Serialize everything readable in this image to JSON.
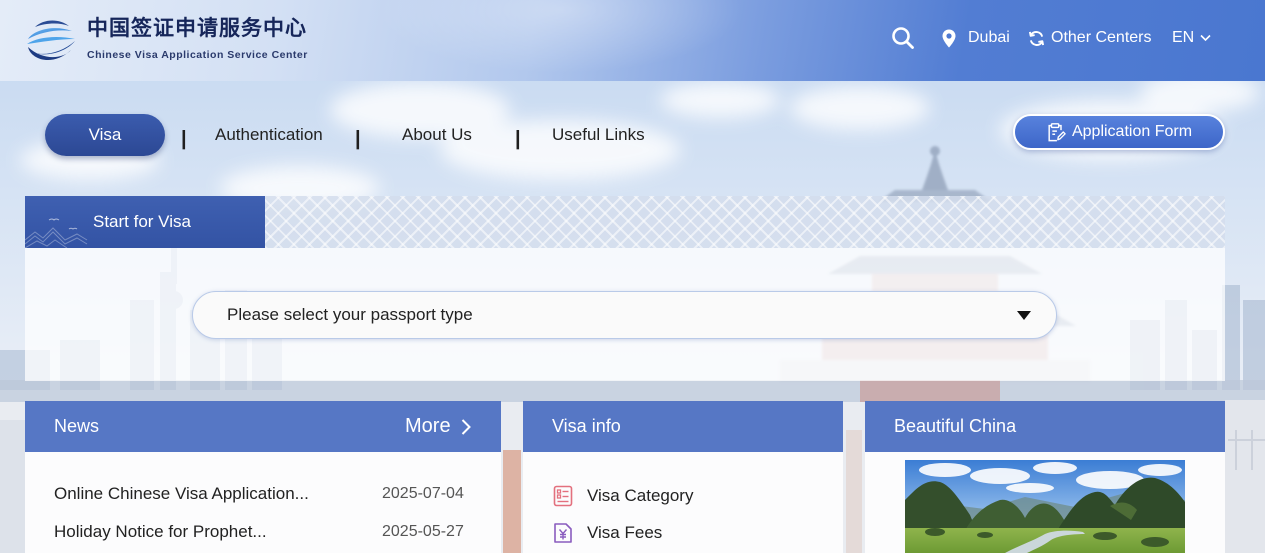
{
  "header": {
    "logo_cn": "中国签证申请服务中心",
    "logo_en": "Chinese Visa Application Service Center",
    "location": "Dubai",
    "other_centers": "Other Centers",
    "language": "EN",
    "icons": {
      "logo": "logo-swoosh-icon",
      "search": "search-icon",
      "location": "location-pin-icon",
      "other_centers": "refresh-icon",
      "language": "chevron-down-icon"
    }
  },
  "nav": {
    "items": [
      {
        "label": "Visa",
        "active": true
      },
      {
        "label": "Authentication",
        "active": false
      },
      {
        "label": "About Us",
        "active": false
      },
      {
        "label": "Useful Links",
        "active": false
      }
    ],
    "separator": "|",
    "application_form": "Application Form",
    "application_form_icon": "form-edit-icon"
  },
  "start_panel": {
    "tab_label": "Start for Visa",
    "passport_select": {
      "placeholder": "Please select your passport type",
      "icon": "dropdown-triangle-icon"
    }
  },
  "news": {
    "title": "News",
    "more": "More",
    "more_icon": "chevron-right-icon",
    "items": [
      {
        "title": "Online Chinese Visa Application...",
        "date": "2025-07-04"
      },
      {
        "title": "Holiday Notice for Prophet...",
        "date": "2025-05-27"
      }
    ]
  },
  "visa_info": {
    "title": "Visa info",
    "items": [
      {
        "label": "Visa Category",
        "icon": "list-document-icon"
      },
      {
        "label": "Visa Fees",
        "icon": "yuan-document-icon"
      }
    ]
  },
  "beautiful_china": {
    "title": "Beautiful China",
    "image": "karst-landscape-photo"
  },
  "colors": {
    "header_blue": "#4a77d0",
    "primary_navy": "#2c4894",
    "tab_blue": "#3353a4",
    "section_header": "#5677c5",
    "visa_category_icon": "#e3707e",
    "visa_fees_icon": "#8a5cbf"
  }
}
